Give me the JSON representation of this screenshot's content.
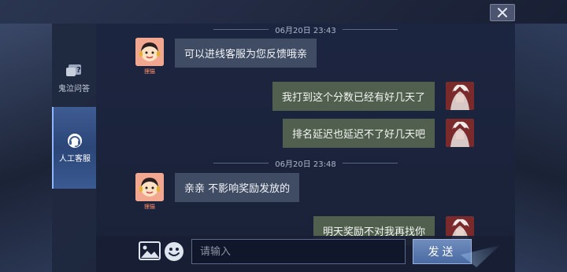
{
  "window": {
    "close_icon": "close-icon"
  },
  "sidebar": {
    "tabs": [
      {
        "label": "鬼泣问答",
        "icon": "question-icon",
        "active": false
      },
      {
        "label": "人工客服",
        "icon": "headset-icon",
        "active": true
      }
    ]
  },
  "chat": {
    "timestamps": [
      "06月20日 23:43",
      "06月20日 23:48"
    ],
    "agent_tag": "狸猫",
    "messages": [
      {
        "from": "agent",
        "text": "可以进线客服为您反馈哦亲"
      },
      {
        "from": "user",
        "text": "我打到这个分数已经有好几天了"
      },
      {
        "from": "user",
        "text": "排名延迟也延迟不了好几天吧"
      },
      {
        "from": "agent",
        "text": "亲亲 不影响奖励发放的"
      },
      {
        "from": "user",
        "text": "明天奖励不对我再找你"
      }
    ]
  },
  "input": {
    "placeholder": "请输入",
    "image_icon": "image-icon",
    "emoji_icon": "emoji-icon",
    "send_label": "发送"
  },
  "colors": {
    "agent_bubble": "#3f4c63",
    "user_bubble": "#505f4e",
    "active_tab": "#3f5c93",
    "send_button": "#5877ad"
  }
}
